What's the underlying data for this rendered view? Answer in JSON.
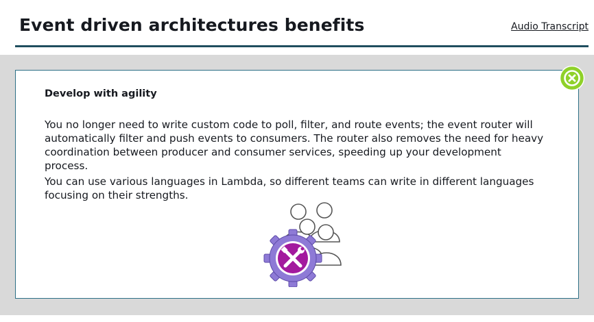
{
  "header": {
    "title": "Event driven architectures benefits",
    "audio_transcript_label": "Audio Transcript"
  },
  "card": {
    "heading": "Develop with agility",
    "paragraphs": [
      "You no longer need to write custom code to poll, filter, and route events; the event router will automatically filter and push events to consumers. The router also removes the need for heavy coordination between producer and consumer services, speeding up your development process.",
      "You can use various languages in Lambda, so different teams can write in different languages focusing on their strengths."
    ],
    "illustration_icon": "people-with-gear-tools-icon"
  },
  "close_icon": "close-icon",
  "colors": {
    "header_rule": "#1f4e5f",
    "card_border": "#2c6f86",
    "stage_background": "#d9d9d9",
    "close_button": "#8fd129",
    "gear": "#8e7ad6",
    "gear_center": "#a3199e"
  }
}
